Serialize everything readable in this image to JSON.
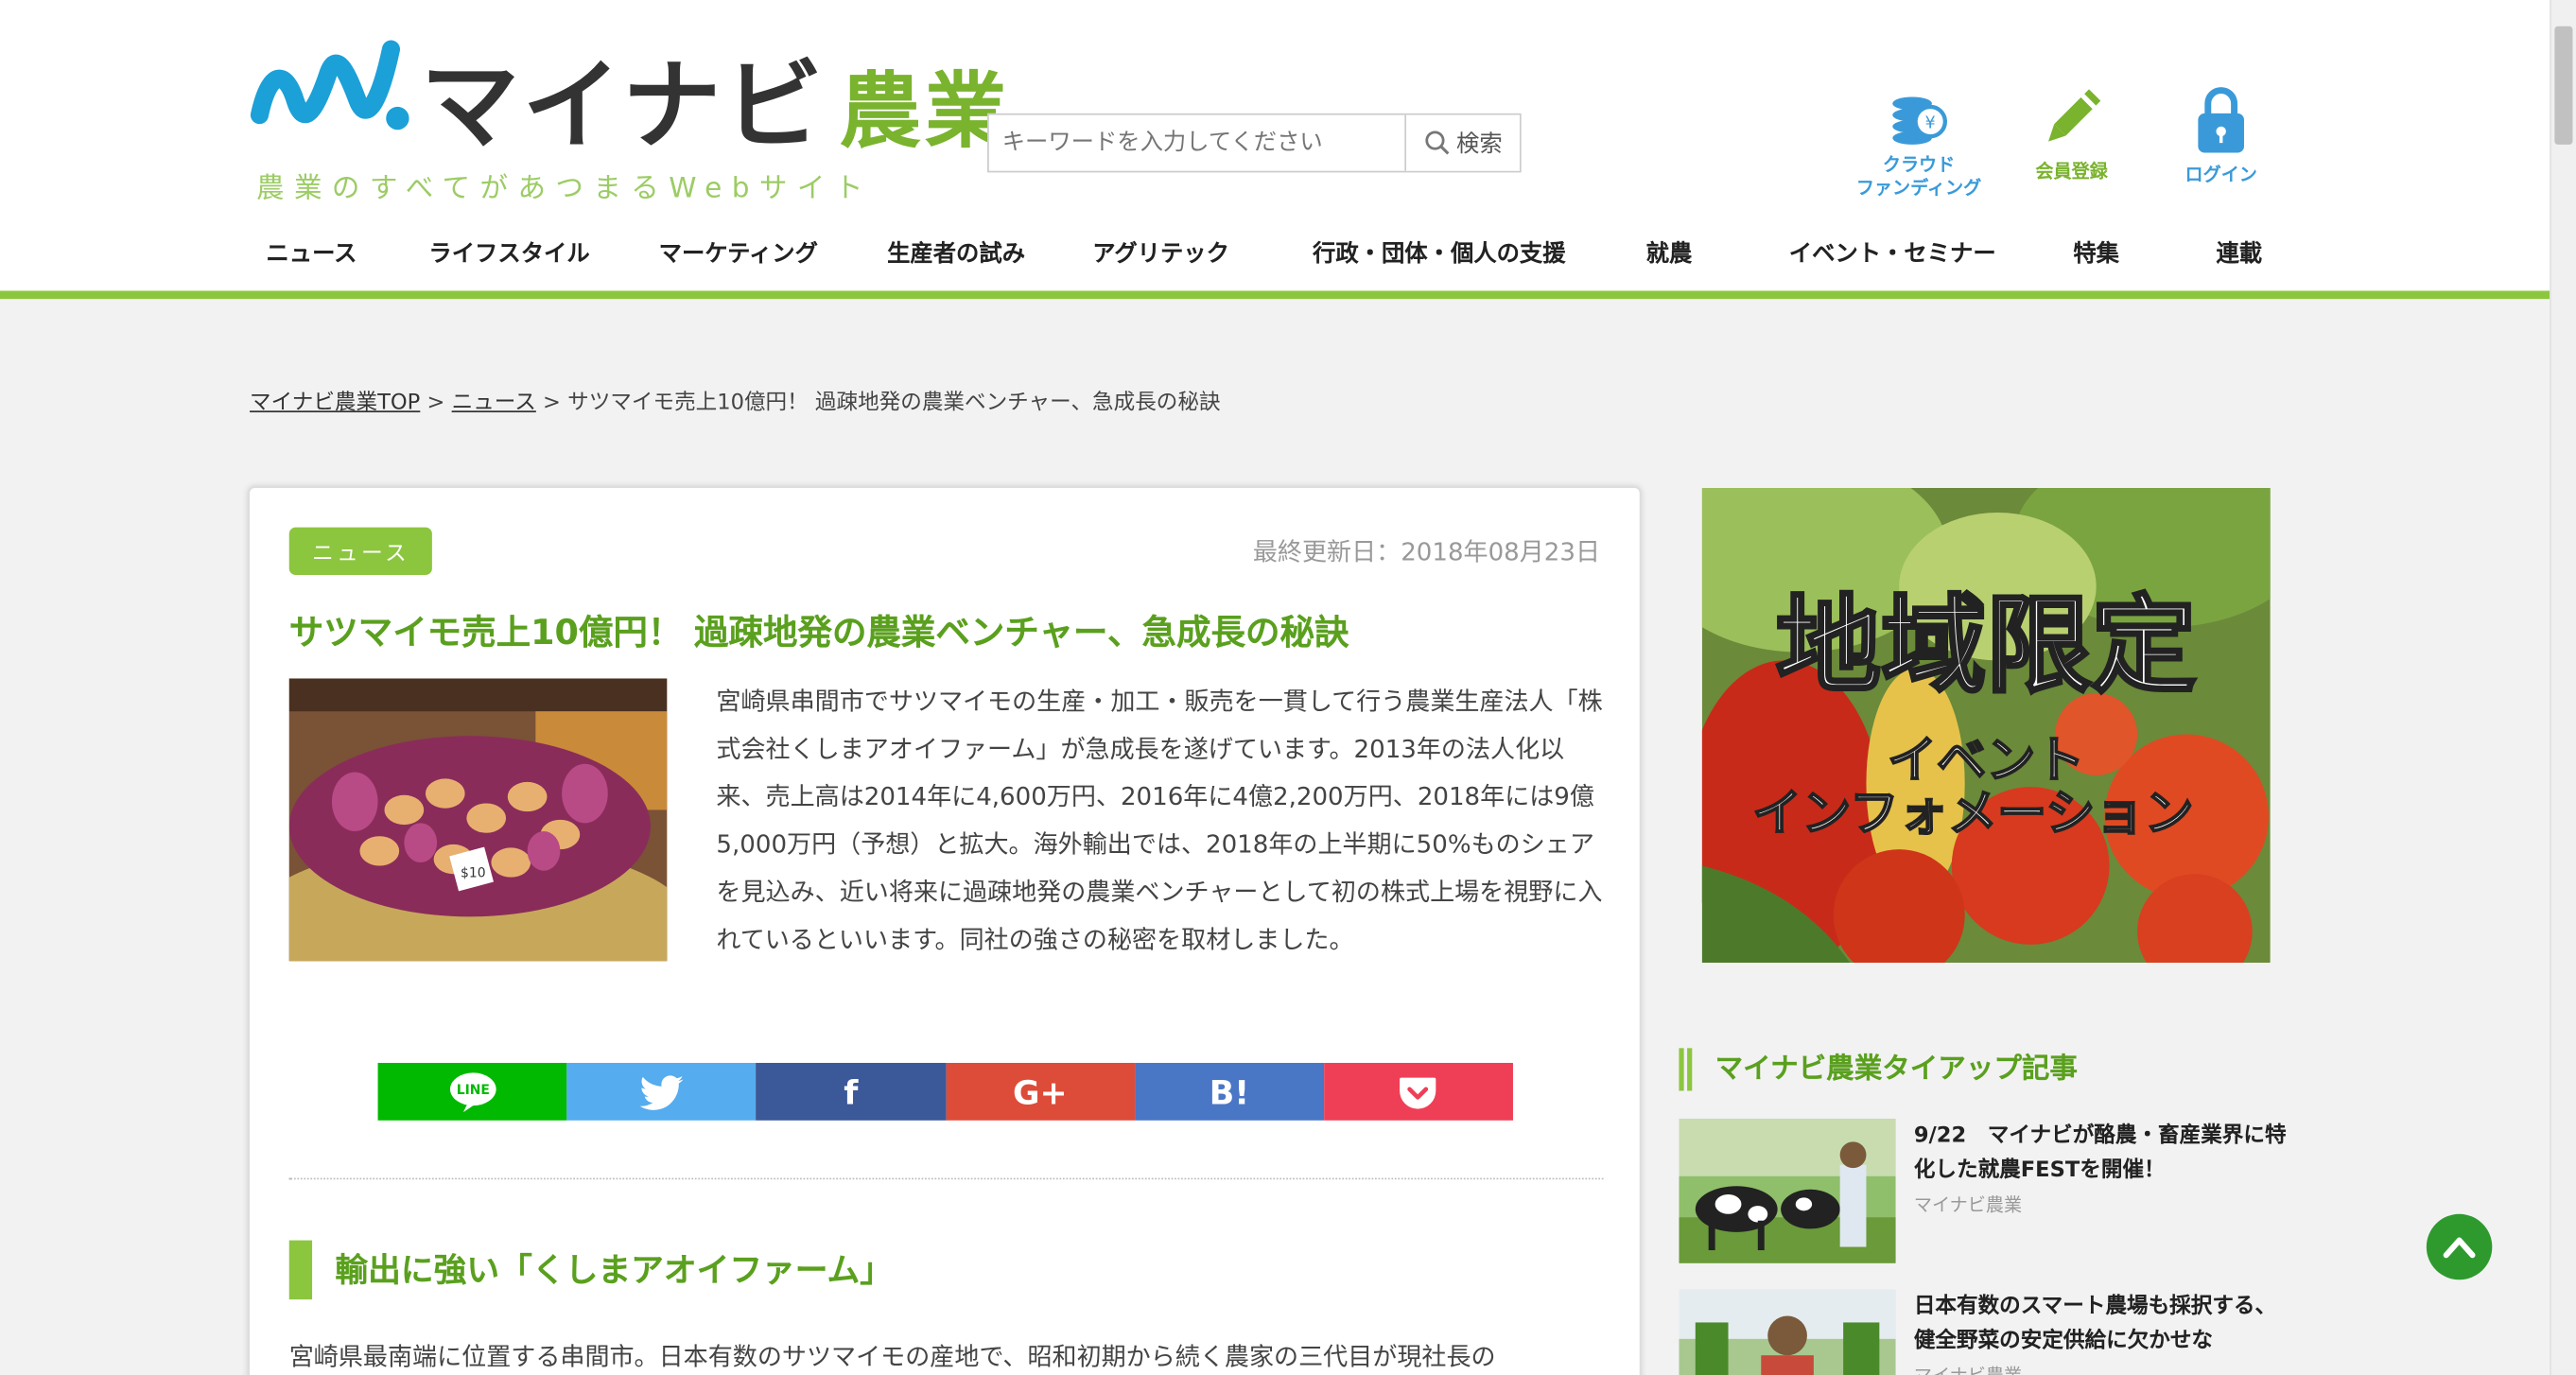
{
  "header": {
    "logo_main": "マイナビ",
    "logo_sub": "農業",
    "tagline": "農業のすべてがあつまるWebサイト",
    "search": {
      "placeholder": "キーワードを入力してください",
      "button_label": "検索"
    },
    "icons": [
      {
        "name": "crowdfunding",
        "label_line1": "クラウド",
        "label_line2": "ファンディング",
        "icon": "coins-yen-icon"
      },
      {
        "name": "register",
        "label_line1": "会員登録",
        "icon": "pencil-icon"
      },
      {
        "name": "login",
        "label_line1": "ログイン",
        "icon": "lock-icon"
      }
    ]
  },
  "nav": {
    "items": [
      "ニュース",
      "ライフスタイル",
      "マーケティング",
      "生産者の試み",
      "アグリテック",
      "行政・団体・個人の支援",
      "就農",
      "イベント・セミナー",
      "特集",
      "連載"
    ]
  },
  "breadcrumb": {
    "home": "マイナビ農業TOP",
    "sep1": " > ",
    "section": "ニュース",
    "sep2": " > ",
    "current": "サツマイモ売上10億円！ 過疎地発の農業ベンチャー、急成長の秘訣"
  },
  "article": {
    "category": "ニュース",
    "updated": "最終更新日：2018年08月23日",
    "title": "サツマイモ売上10億円！ 過疎地発の農業ベンチャー、急成長の秘訣",
    "lead": "宮崎県串間市でサツマイモの生産・加工・販売を一貫して行う農業生産法人「株式会社くしまアオイファーム」が急成長を遂げています。2013年の法人化以来、売上高は2014年に4,600万円、2016年に4億2,200万円、2018年には9億5,000万円（予想）と拡大。海外輸出では、2018年の上半期に50%ものシェアを見込み、近い将来に過疎地発の農業ベンチャーとして初の株式上場を視野に入れているといいます。同社の強さの秘密を取材しました。",
    "photo_price": "$10",
    "share": [
      {
        "name": "line",
        "label": "LINE",
        "color": "#00b900"
      },
      {
        "name": "twitter",
        "label": "",
        "color": "#55acee"
      },
      {
        "name": "facebook",
        "label": "f",
        "color": "#3b5998"
      },
      {
        "name": "googleplus",
        "label": "G+",
        "color": "#dd4b39"
      },
      {
        "name": "hatena",
        "label": "B!",
        "color": "#4a76c6"
      },
      {
        "name": "pocket",
        "label": "",
        "color": "#ef3f56"
      }
    ],
    "section_heading": "輸出に強い「くしまアオイファーム」",
    "body_start": "宮崎県最南端に位置する串間市。日本有数のサツマイモの産地で、昭和初期から続く農家の三代目が現社長の"
  },
  "sidebar": {
    "banner_title": "地域限定",
    "banner_sub1": "イベント",
    "banner_sub2": "インフォメーション",
    "tieup_heading": "マイナビ農業タイアップ記事",
    "tieups": [
      {
        "title": "9/22　マイナビが酪農・畜産業界に特化した就農FESTを開催！",
        "source": "マイナビ農業"
      },
      {
        "title": "日本有数のスマート農場も採択する、健全野菜の安定供給に欠かせな",
        "source": "マイナビ農業"
      }
    ]
  },
  "colors": {
    "brand_green": "#8cc63f",
    "title_green": "#5aa01e",
    "brand_blue": "#1ca0d8"
  }
}
